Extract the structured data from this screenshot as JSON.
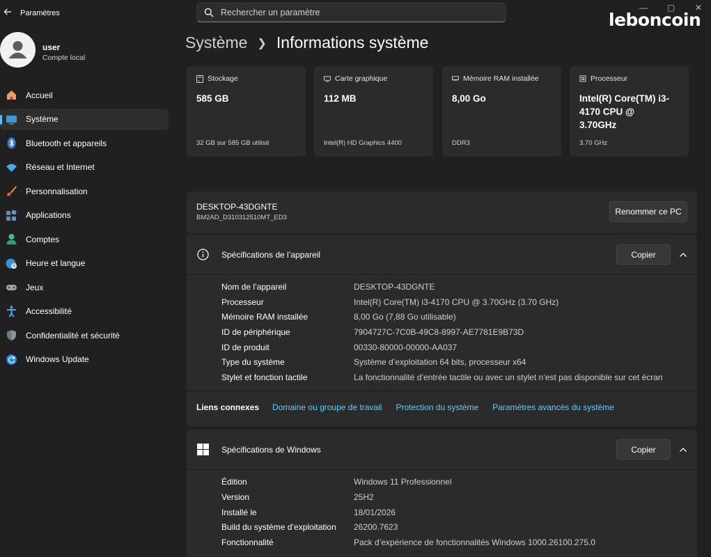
{
  "app": {
    "title": "Paramètres",
    "back_icon": "arrow-left-icon"
  },
  "search": {
    "placeholder": "Rechercher un paramètre"
  },
  "watermark": "leboncoin",
  "user": {
    "name": "user",
    "account_type": "Compte local"
  },
  "sidebar": {
    "items": [
      {
        "label": "Accueil",
        "icon": "home-icon",
        "active": false
      },
      {
        "label": "Système",
        "icon": "monitor-icon",
        "active": true
      },
      {
        "label": "Bluetooth et appareils",
        "icon": "bluetooth-icon",
        "active": false
      },
      {
        "label": "Réseau et Internet",
        "icon": "wifi-icon",
        "active": false
      },
      {
        "label": "Personnalisation",
        "icon": "brush-icon",
        "active": false
      },
      {
        "label": "Applications",
        "icon": "apps-icon",
        "active": false
      },
      {
        "label": "Comptes",
        "icon": "person-icon",
        "active": false
      },
      {
        "label": "Heure et langue",
        "icon": "globe-clock-icon",
        "active": false
      },
      {
        "label": "Jeux",
        "icon": "gamepad-icon",
        "active": false
      },
      {
        "label": "Accessibilité",
        "icon": "accessibility-icon",
        "active": false
      },
      {
        "label": "Confidentialité et sécurité",
        "icon": "shield-icon",
        "active": false
      },
      {
        "label": "Windows Update",
        "icon": "update-icon",
        "active": false
      }
    ]
  },
  "breadcrumb": {
    "parent": "Système",
    "current": "Informations système"
  },
  "cards": [
    {
      "title": "Stockage",
      "value": "585 GB",
      "sub": "32 GB sur 585 GB utilisé",
      "icon": "storage-icon"
    },
    {
      "title": "Carte graphique",
      "value": "112 MB",
      "sub": "Intel(R) HD Graphics 4400",
      "icon": "gpu-icon"
    },
    {
      "title": "Mémoire RAM installée",
      "value": "8,00 Go",
      "sub": "DDR3",
      "icon": "ram-icon"
    },
    {
      "title": "Processeur",
      "value": "Intel(R) Core(TM) i3-4170 CPU @ 3.70GHz",
      "sub": "3.70 GHz",
      "icon": "cpu-icon"
    }
  ],
  "device": {
    "name": "DESKTOP-43DGNTE",
    "model": "BM2AD_D310312510MT_ED3",
    "rename_label": "Renommer ce PC"
  },
  "device_specs": {
    "title": "Spécifications de l’appareil",
    "copy_label": "Copier",
    "rows": [
      {
        "label": "Nom de l’appareil",
        "value": "DESKTOP-43DGNTE"
      },
      {
        "label": "Processeur",
        "value": "Intel(R) Core(TM) i3-4170 CPU @ 3.70GHz (3.70 GHz)"
      },
      {
        "label": "Mémoire RAM installée",
        "value": "8,00 Go (7,88 Go utilisable)"
      },
      {
        "label": "ID de périphérique",
        "value": "7904727C-7C0B-49C8-8997-AE7781E9B73D"
      },
      {
        "label": "ID de produit",
        "value": "00330-80000-00000-AA037"
      },
      {
        "label": "Type du système",
        "value": "Système d’exploitation 64 bits, processeur x64"
      },
      {
        "label": "Stylet et fonction tactile",
        "value": "La fonctionnalité d’entrée tactile ou avec un stylet n’est pas disponible sur cet écran"
      }
    ]
  },
  "related_links": {
    "label": "Liens connexes",
    "links": [
      "Domaine ou groupe de travail",
      "Protection du système",
      "Paramètres avancés du système"
    ]
  },
  "windows_specs": {
    "title": "Spécifications de Windows",
    "copy_label": "Copier",
    "rows": [
      {
        "label": "Édition",
        "value": "Windows 11 Professionnel"
      },
      {
        "label": "Version",
        "value": "25H2"
      },
      {
        "label": "Installé le",
        "value": "18/01/2026"
      },
      {
        "label": "Build du système d’exploitation",
        "value": "26200.7623"
      },
      {
        "label": "Fonctionnalité",
        "value": "Pack d’expérience de fonctionnalités Windows 1000.26100.275.0"
      }
    ]
  },
  "accent_color": "#4cc2ff",
  "link_color": "#60cdff"
}
